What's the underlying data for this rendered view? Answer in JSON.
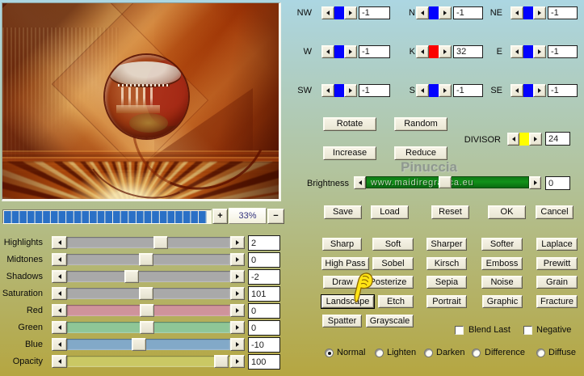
{
  "preview": {
    "zoom_in": "+",
    "zoom_out": "−",
    "zoom_level": "33%"
  },
  "direction_spinners": [
    {
      "label": "NW",
      "value": "-1",
      "thumb_color": "#0302ff"
    },
    {
      "label": "N",
      "value": "-1",
      "thumb_color": "#0302ff"
    },
    {
      "label": "NE",
      "value": "-1",
      "thumb_color": "#0302ff"
    },
    {
      "label": "W",
      "value": "-1",
      "thumb_color": "#0302ff"
    },
    {
      "label": "K",
      "value": "32",
      "thumb_color": "#fc0001"
    },
    {
      "label": "E",
      "value": "-1",
      "thumb_color": "#0302ff"
    },
    {
      "label": "SW",
      "value": "-1",
      "thumb_color": "#0302ff"
    },
    {
      "label": "S",
      "value": "-1",
      "thumb_color": "#0302ff"
    },
    {
      "label": "SE",
      "value": "-1",
      "thumb_color": "#0302ff"
    }
  ],
  "transform_buttons": {
    "rotate": "Rotate",
    "random": "Random",
    "increase": "Increase",
    "reduce": "Reduce"
  },
  "divisor": {
    "label": "DIVISOR",
    "value": "24",
    "thumb_color": "#fffe00"
  },
  "watermark": "Pinuccia",
  "brightness": {
    "label": "Brightness",
    "value": "0",
    "bar_text": "www.maidiregrafica.eu",
    "bar_color": "#12771a"
  },
  "action_buttons": [
    "Save",
    "Load",
    "Reset",
    "OK",
    "Cancel"
  ],
  "sliders": [
    {
      "label": "Highlights",
      "value": "2",
      "pos": 0.582,
      "track_color": "#a9a9a9"
    },
    {
      "label": "Midtones",
      "value": "0",
      "pos": 0.484,
      "track_color": "#a9a9a9"
    },
    {
      "label": "Shadows",
      "value": "-2",
      "pos": 0.386,
      "track_color": "#a9a9a9"
    },
    {
      "label": "Saturation",
      "value": "101",
      "pos": 0.484,
      "track_color": "#a9a9a9"
    },
    {
      "label": "Red",
      "value": "0",
      "pos": 0.489,
      "track_color": "#cf939b"
    },
    {
      "label": "Green",
      "value": "0",
      "pos": 0.489,
      "track_color": "#8ec697"
    },
    {
      "label": "Blue",
      "value": "-10",
      "pos": 0.435,
      "track_color": "#82a9c8"
    },
    {
      "label": "Opacity",
      "value": "100",
      "pos": 0.989,
      "track_color": "#cac864"
    }
  ],
  "effects": {
    "rows": [
      [
        "Sharp",
        "Soft",
        "Sharper",
        "Softer",
        "Laplace"
      ],
      [
        "High Pass",
        "Sobel",
        "Kirsch",
        "Emboss",
        "Prewitt"
      ],
      [
        "Draw",
        "Posterize",
        "Sepia",
        "Noise",
        "Grain"
      ],
      [
        "Landscape",
        "Etch",
        "Portrait",
        "Graphic",
        "Fracture"
      ],
      [
        "Spatter",
        "Grayscale"
      ]
    ],
    "focused": "Landscape"
  },
  "checkboxes": [
    {
      "label": "Blend Last",
      "checked": false
    },
    {
      "label": "Negative",
      "checked": false
    }
  ],
  "blend_modes": {
    "options": [
      "Normal",
      "Lighten",
      "Darken",
      "Difference",
      "Diffuse"
    ],
    "selected": "Normal"
  }
}
